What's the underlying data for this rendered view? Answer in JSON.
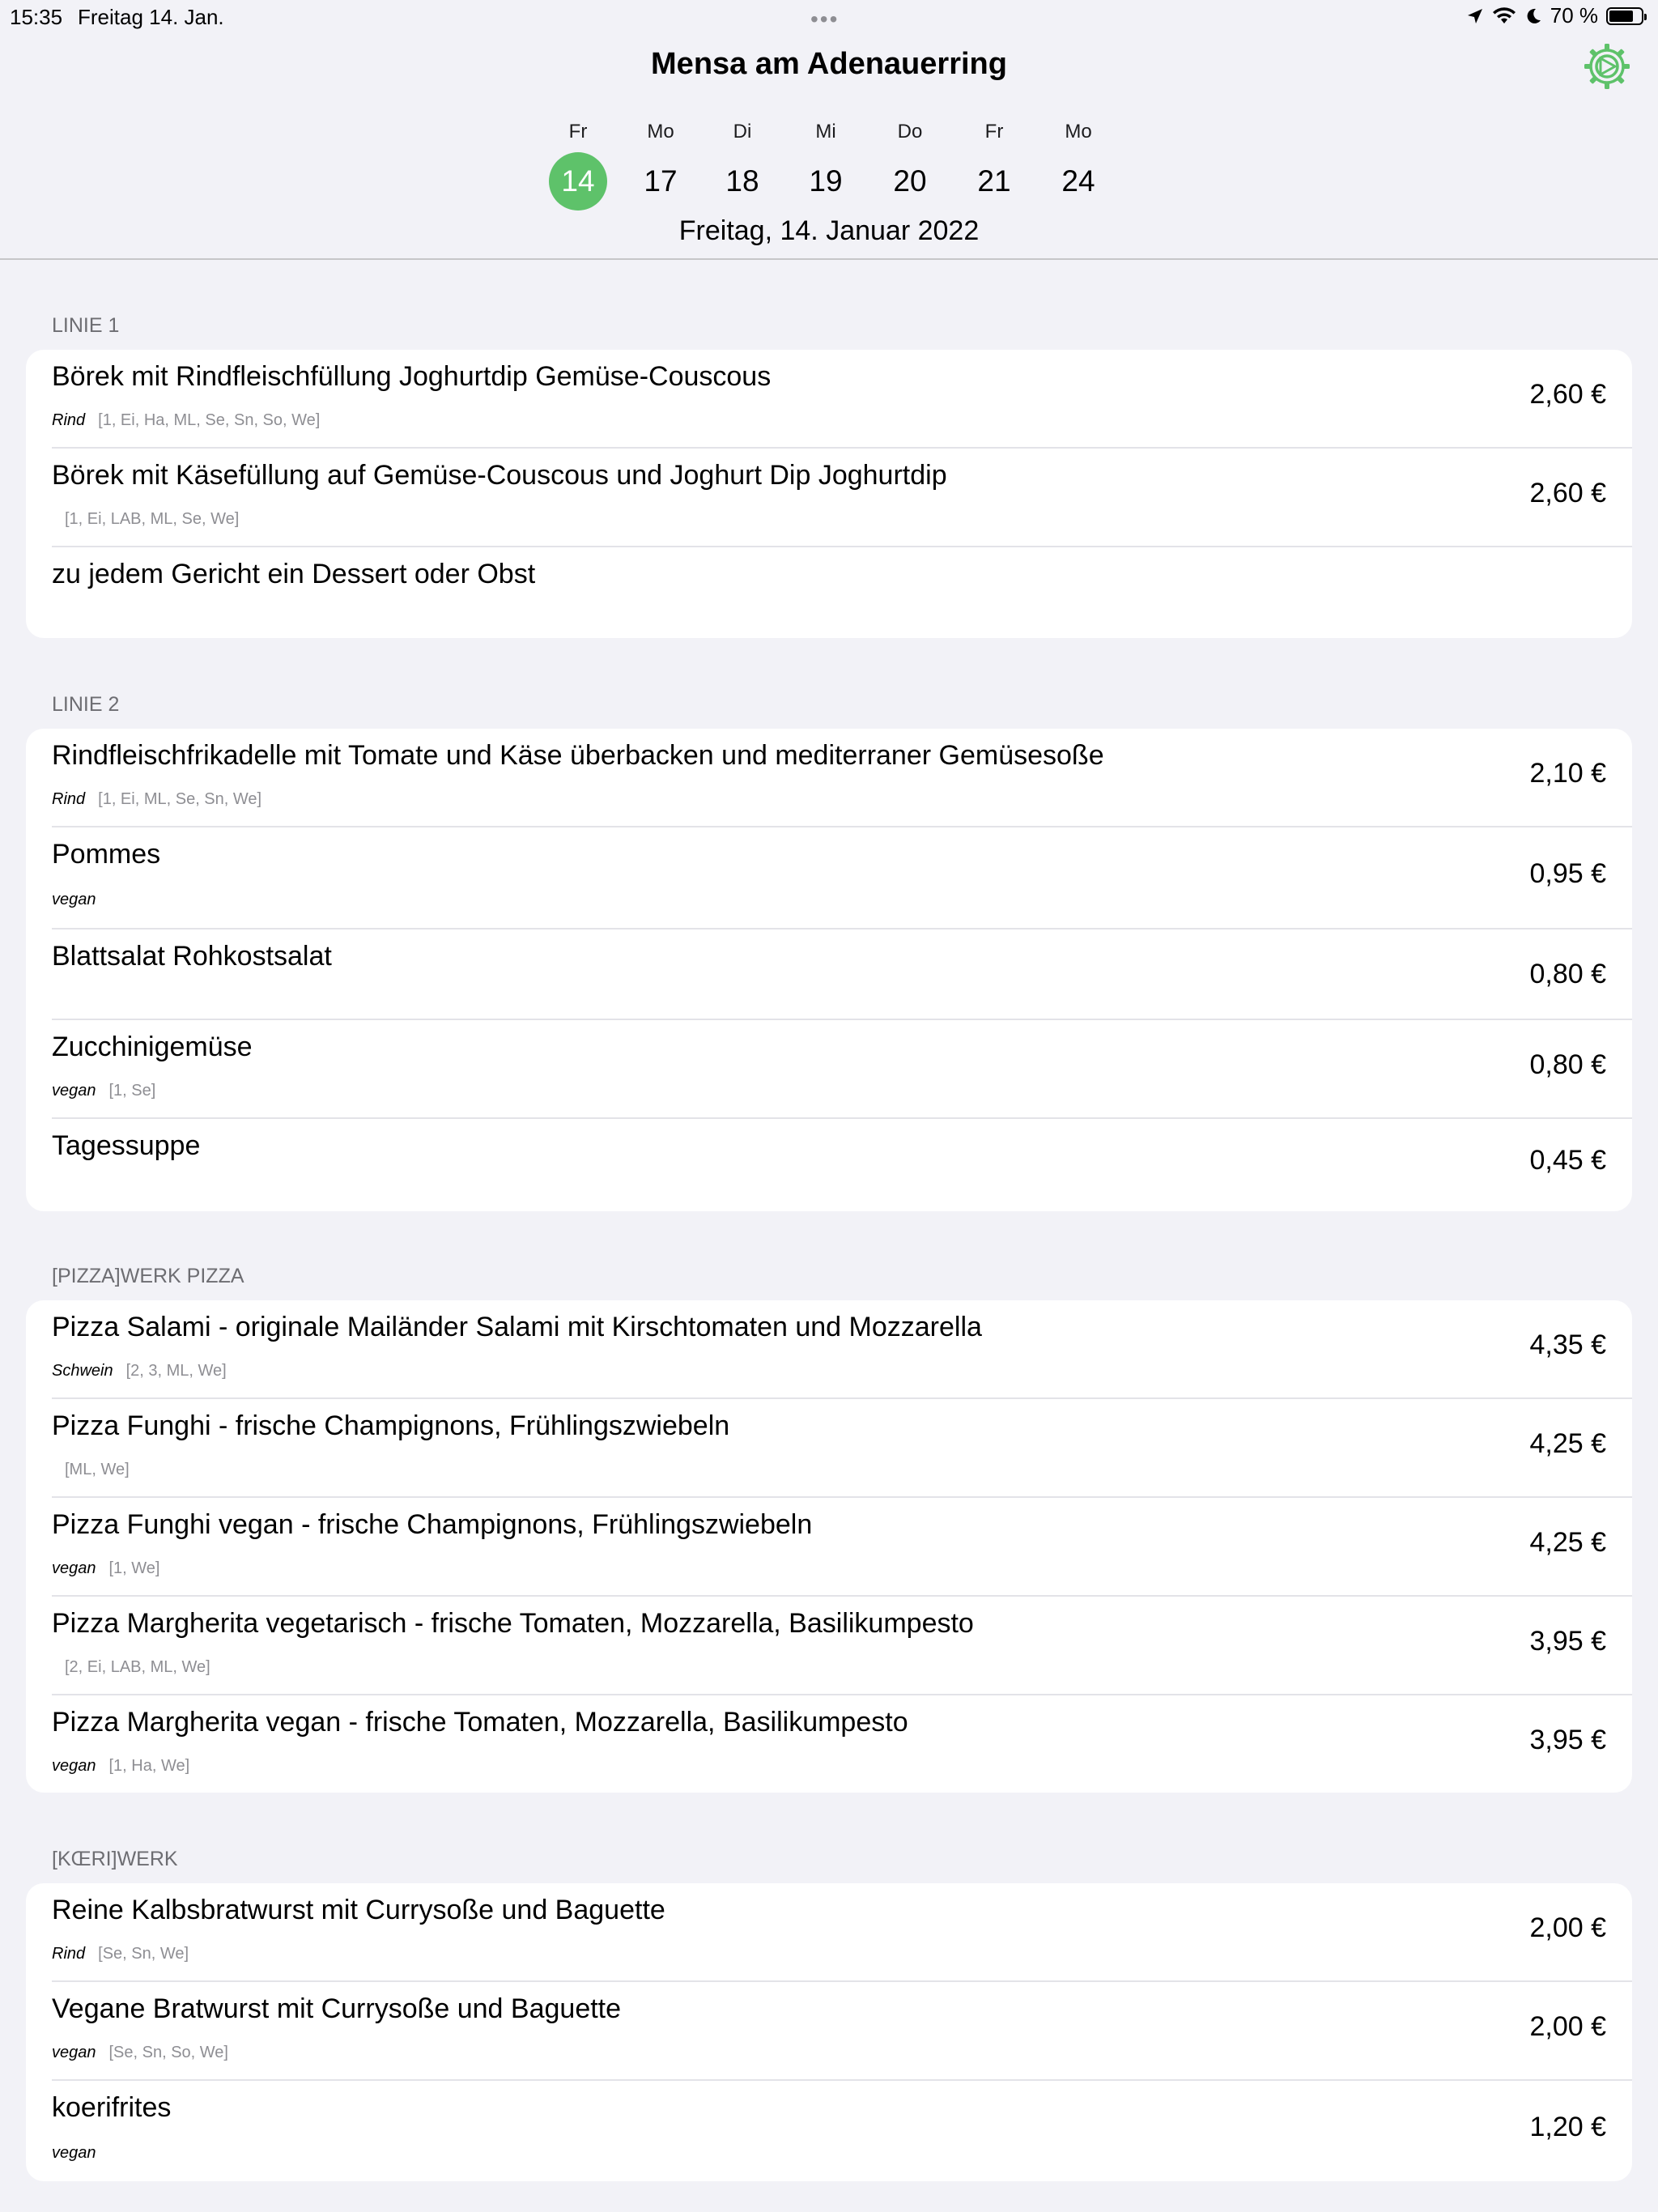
{
  "status": {
    "time": "15:35",
    "date": "Freitag 14. Jan.",
    "battery": "70 %"
  },
  "header": {
    "title": "Mensa am Adenauerring"
  },
  "days": [
    {
      "wd": "Fr",
      "num": "14"
    },
    {
      "wd": "Mo",
      "num": "17"
    },
    {
      "wd": "Di",
      "num": "18"
    },
    {
      "wd": "Mi",
      "num": "19"
    },
    {
      "wd": "Do",
      "num": "20"
    },
    {
      "wd": "Fr",
      "num": "21"
    },
    {
      "wd": "Mo",
      "num": "24"
    }
  ],
  "selected_date": "Freitag, 14. Januar 2022",
  "colors": {
    "accent": "#5ec26a",
    "background": "#f2f2f7"
  },
  "sections": [
    {
      "title": "LINIE 1",
      "items": [
        {
          "name": "Börek mit Rindfleischfüllung Joghurtdip Gemüse-Couscous",
          "tag": "Rind",
          "allergens": "[1, Ei, Ha, ML, Se, Sn, So, We]",
          "price": "2,60 €"
        },
        {
          "name": "Börek mit Käsefüllung auf Gemüse-Couscous und Joghurt Dip Joghurtdip",
          "tag": "",
          "allergens": "[1, Ei, LAB, ML, Se, We]",
          "price": "2,60 €"
        },
        {
          "name": "zu jedem Gericht ein Dessert oder Obst",
          "tag": "",
          "allergens": "",
          "price": ""
        }
      ]
    },
    {
      "title": "LINIE 2",
      "items": [
        {
          "name": "Rindfleischfrikadelle mit Tomate und Käse überbacken und mediterraner Gemüsesoße",
          "tag": "Rind",
          "allergens": "[1, Ei, ML, Se, Sn, We]",
          "price": "2,10 €"
        },
        {
          "name": "Pommes",
          "tag": "vegan",
          "allergens": "",
          "price": "0,95 €"
        },
        {
          "name": "Blattsalat Rohkostsalat",
          "tag": "",
          "allergens": "",
          "price": "0,80 €"
        },
        {
          "name": "Zucchinigemüse",
          "tag": "vegan",
          "allergens": "[1, Se]",
          "price": "0,80 €"
        },
        {
          "name": "Tagessuppe",
          "tag": "",
          "allergens": "",
          "price": "0,45 €"
        }
      ]
    },
    {
      "title": "[PIZZA]WERK PIZZA",
      "items": [
        {
          "name": "Pizza Salami - originale Mailänder Salami mit Kirschtomaten und Mozzarella",
          "tag": "Schwein",
          "allergens": "[2, 3, ML, We]",
          "price": "4,35 €"
        },
        {
          "name": "Pizza Funghi - frische Champignons, Frühlingszwiebeln",
          "tag": "",
          "allergens": "[ML, We]",
          "price": "4,25 €"
        },
        {
          "name": "Pizza Funghi vegan - frische Champignons, Frühlingszwiebeln",
          "tag": "vegan",
          "allergens": "[1, We]",
          "price": "4,25 €"
        },
        {
          "name": "Pizza Margherita vegetarisch - frische Tomaten, Mozzarella, Basilikumpesto",
          "tag": "",
          "allergens": "[2, Ei, LAB, ML, We]",
          "price": "3,95 €"
        },
        {
          "name": "Pizza Margherita vegan - frische Tomaten, Mozzarella, Basilikumpesto",
          "tag": "vegan",
          "allergens": "[1, Ha, We]",
          "price": "3,95 €"
        }
      ]
    },
    {
      "title": "[KŒRI]WERK",
      "items": [
        {
          "name": "Reine Kalbsbratwurst mit Currysoße und Baguette",
          "tag": "Rind",
          "allergens": "[Se, Sn, We]",
          "price": "2,00 €"
        },
        {
          "name": "Vegane Bratwurst mit Currysoße und Baguette",
          "tag": "vegan",
          "allergens": "[Se, Sn, So, We]",
          "price": "2,00 €"
        },
        {
          "name": "koerifrites",
          "tag": "vegan",
          "allergens": "",
          "price": "1,20 €"
        }
      ]
    }
  ]
}
